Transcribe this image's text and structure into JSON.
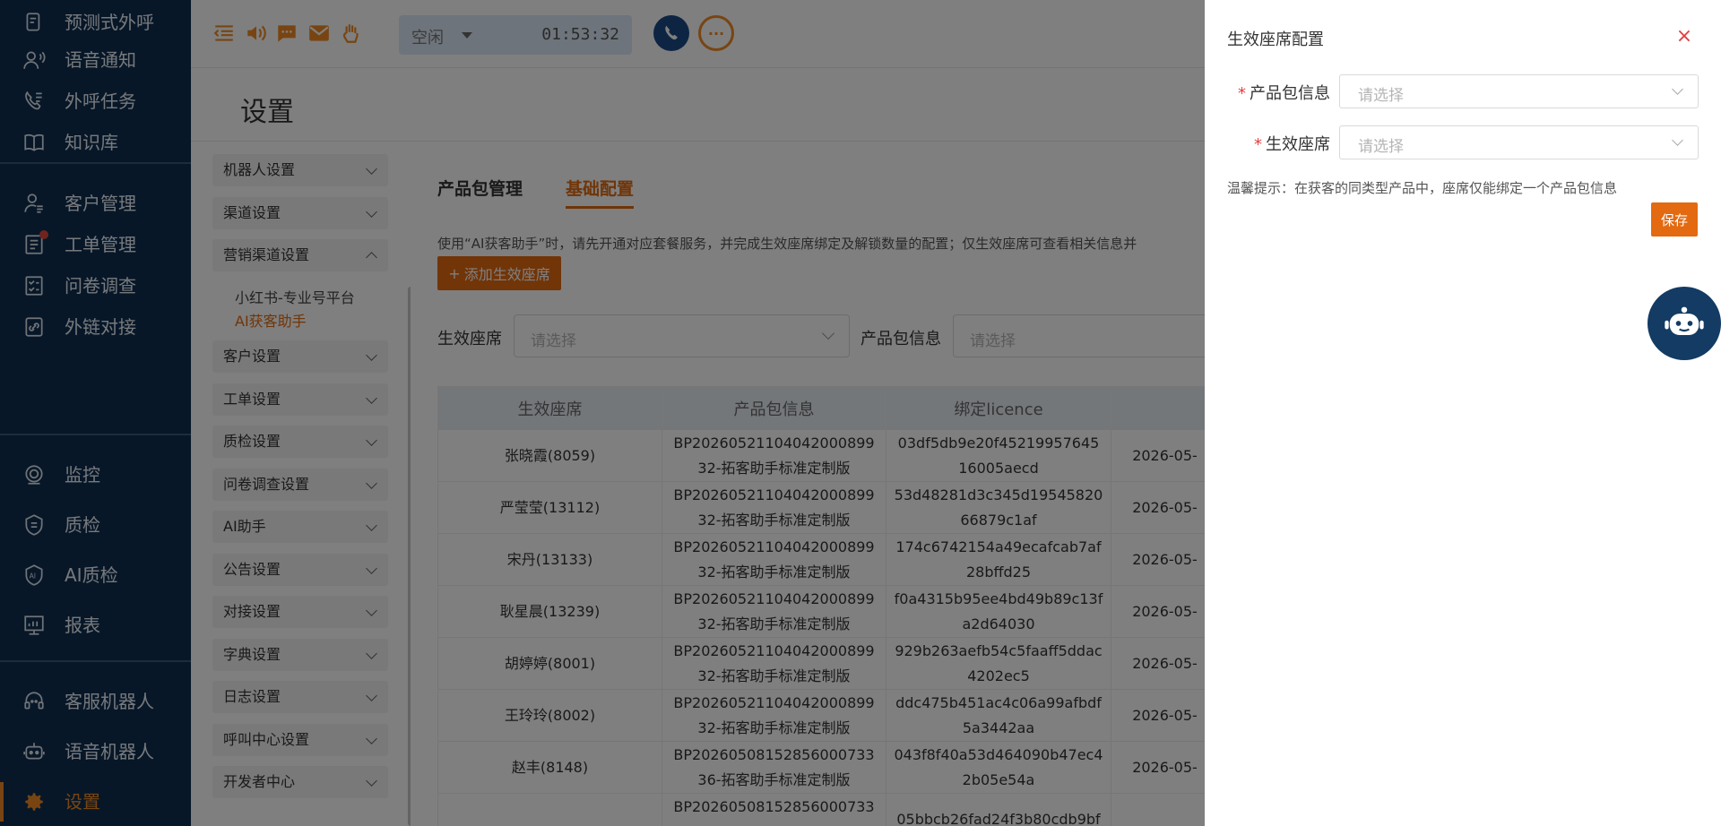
{
  "nav": {
    "items": [
      {
        "label": "预测式外呼",
        "icon": "predictive-call-icon"
      },
      {
        "label": "语音通知",
        "icon": "voice-notice-icon"
      },
      {
        "label": "外呼任务",
        "icon": "outbound-task-icon"
      },
      {
        "label": "知识库",
        "icon": "book-icon"
      },
      {
        "label": "客户管理",
        "icon": "customer-icon"
      },
      {
        "label": "工单管理",
        "icon": "ticket-icon"
      },
      {
        "label": "问卷调查",
        "icon": "survey-icon"
      },
      {
        "label": "外链对接",
        "icon": "link-icon"
      },
      {
        "label": "监控",
        "icon": "monitor-icon"
      },
      {
        "label": "质检",
        "icon": "quality-icon"
      },
      {
        "label": "AI质检",
        "icon": "ai-quality-icon"
      },
      {
        "label": "报表",
        "icon": "report-icon"
      },
      {
        "label": "客服机器人",
        "icon": "service-bot-icon"
      },
      {
        "label": "语音机器人",
        "icon": "voice-bot-icon"
      },
      {
        "label": "设置",
        "icon": "gear-icon"
      }
    ]
  },
  "topbar": {
    "status": "空闲",
    "timer": "01:53:32",
    "chat_glyph": "···"
  },
  "page": {
    "title": "设置"
  },
  "submenu": {
    "items": [
      "机器人设置",
      "渠道设置",
      "营销渠道设置",
      "客户设置",
      "工单设置",
      "质检设置",
      "问卷调查设置",
      "AI助手",
      "公告设置",
      "对接设置",
      "字典设置",
      "日志设置",
      "呼叫中心设置",
      "开发者中心"
    ],
    "children": [
      "小红书-专业号平台",
      "AI获客助手"
    ]
  },
  "main": {
    "tabs": [
      "产品包管理",
      "基础配置"
    ],
    "notice": "使用“AI获客助手”时，请先开通对应套餐服务，并完成生效座席绑定及解锁数量的配置；仅生效座席可查看相关信息并",
    "add_button": "添加生效座席",
    "filter_seat_label": "生效座席",
    "filter_seat_placeholder": "请选择",
    "filter_pkg_label": "产品包信息",
    "filter_pkg_placeholder": "请选择",
    "table": {
      "headers": [
        "生效座席",
        "产品包信息",
        "绑定licence",
        ""
      ],
      "rows": [
        [
          "张晓霞(8059)",
          "BP2026052110404200089932-拓客助手标准定制版",
          "03df5db9e20f4521995764516005aecd",
          "2026-05-"
        ],
        [
          "严莹莹(13112)",
          "BP2026052110404200089932-拓客助手标准定制版",
          "53d48281d3c345d1954582066879c1af",
          "2026-05-"
        ],
        [
          "宋丹(13133)",
          "BP2026052110404200089932-拓客助手标准定制版",
          "174c6742154a49ecafcab7af28bffd25",
          "2026-05-"
        ],
        [
          "耿星晨(13239)",
          "BP2026052110404200089932-拓客助手标准定制版",
          "f0a4315b95ee4bd49b89c13fa2d64030",
          "2026-05-"
        ],
        [
          "胡婷婷(8001)",
          "BP2026052110404200089932-拓客助手标准定制版",
          "929b263aefb54c5faaff5ddac4202ec5",
          "2026-05-"
        ],
        [
          "王玲玲(8002)",
          "BP2026052110404200089932-拓客助手标准定制版",
          "ddc475b451ac4c06a99afbdf5a3442aa",
          "2026-05-"
        ],
        [
          "赵丰(8148)",
          "BP2026050815285600073336-拓客助手标准定制版",
          "043f8f40a53d464090b47ec42b05e54a",
          "2026-05-"
        ],
        [
          "",
          "BP202605081528560007333",
          "05bbcb26fad24f3b80cdb9bf",
          ""
        ]
      ]
    }
  },
  "drawer": {
    "title": "生效座席配置",
    "close": "×",
    "field1_label": "产品包信息",
    "field1_placeholder": "请选择",
    "field2_label": "生效座席",
    "field2_placeholder": "请选择",
    "required_mark": "*",
    "tip": "温馨提示：在获客的同类型产品中，座席仅能绑定一个产品包信息",
    "save": "保存"
  }
}
